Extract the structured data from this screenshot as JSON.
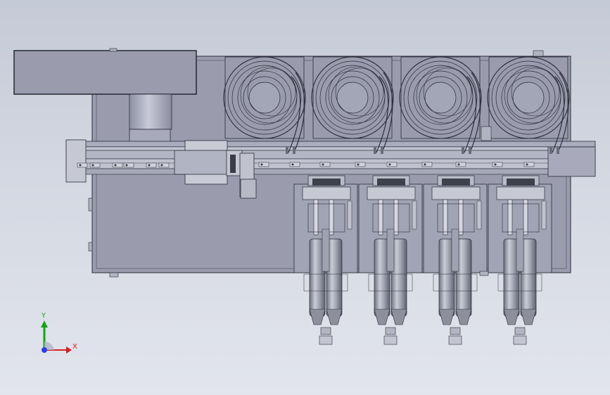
{
  "viewport": {
    "background_top": "#c4cad6",
    "background_bottom": "#e2e5ec"
  },
  "model": {
    "body_color": "#9a9cad",
    "edge_color": "#2a2b38",
    "metal_color": "#b8bcc6",
    "reel_count": 4,
    "actuator_count": 4
  },
  "triad": {
    "y_label": "Y",
    "x_label": "X",
    "y_color": "#17a317",
    "x_color": "#d42020",
    "z_color": "#2b3ee8"
  }
}
